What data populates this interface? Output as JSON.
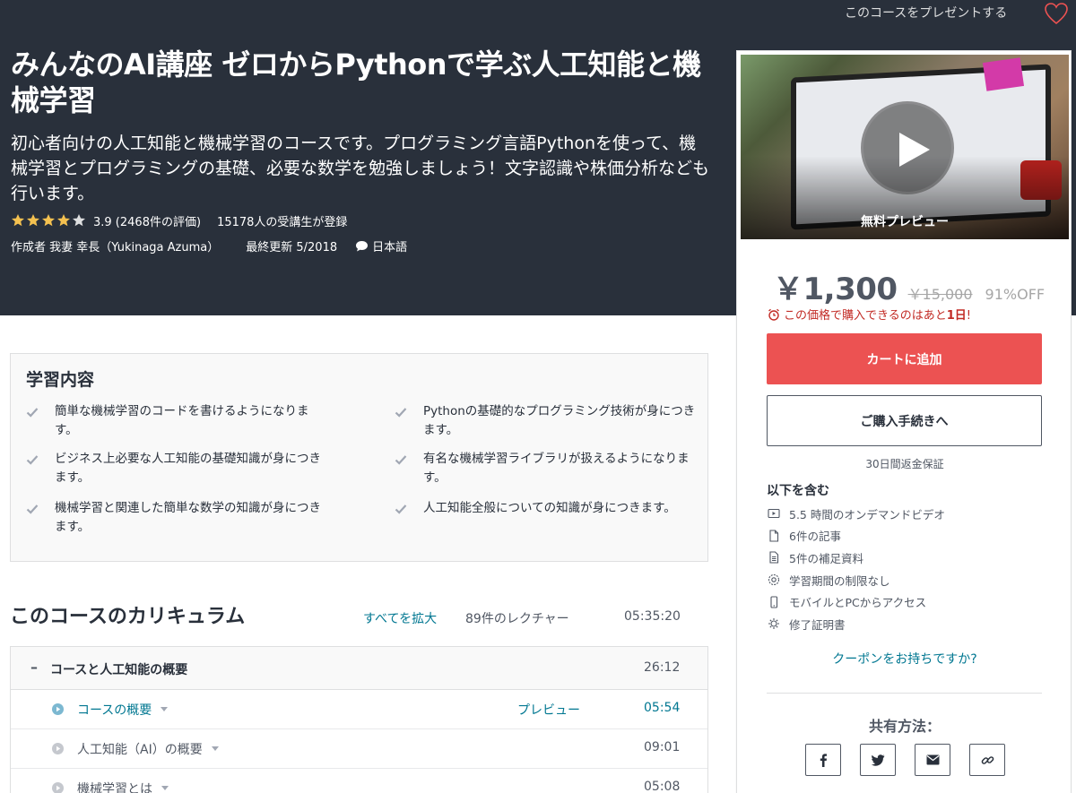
{
  "header": {
    "gift_label": "このコースをプレゼントする",
    "wishlist_icon": "heart-icon"
  },
  "course": {
    "title": "みんなのAI講座 ゼロからPythonで学ぶ人工知能と機械学習",
    "subtitle": "初心者向けの人工知能と機械学習のコースです。プログラミング言語Pythonを使って、機械学習とプログラミングの基礎、必要な数学を勉強しましょう！文字認識や株価分析なども行います。",
    "rating": 3.9,
    "rating_text": "3.9 (2468件の評価)",
    "stars_filled": 4,
    "stars_total": 5,
    "enrolled": "15178人の受講生が登録",
    "author": "作成者 我妻 幸長（Yukinaga Azuma）",
    "updated": "最終更新 5/2018",
    "language": "日本語",
    "star_color": "#f4c150"
  },
  "sidebar": {
    "preview_label": "無料プレビュー",
    "price": "￥1,300",
    "original_price": "￥15,000",
    "discount": "91%OFF",
    "timer_prefix": "この価格で購入できるのはあと",
    "timer_days": "1日",
    "timer_suffix": "!",
    "add_to_cart": "カートに追加",
    "buy_now": "ご購入手続きへ",
    "guarantee": "30日間返金保証",
    "includes_title": "以下を含む",
    "includes": [
      {
        "icon": "video-icon",
        "label": "5.5 時間のオンデマンドビデオ"
      },
      {
        "icon": "file-icon",
        "label": "6件の記事"
      },
      {
        "icon": "document-icon",
        "label": "5件の補足資料"
      },
      {
        "icon": "infinity-icon",
        "label": "学習期間の制限なし"
      },
      {
        "icon": "mobile-icon",
        "label": "モバイルとPCからアクセス"
      },
      {
        "icon": "certificate-icon",
        "label": "修了証明書"
      }
    ],
    "coupon": "クーポンをお持ちですか?",
    "share_title": "共有方法：",
    "share_icons": [
      "facebook-icon",
      "twitter-icon",
      "email-icon",
      "link-icon"
    ],
    "cart_color": "#ec5252"
  },
  "learn": {
    "title": "学習内容",
    "items": [
      "簡単な機械学習のコードを書けるようになります。",
      "Pythonの基礎的なプログラミング技術が身につきます。",
      "ビジネス上必要な人工知能の基礎知識が身につきます。",
      "有名な機械学習ライブラリが扱えるようになります。",
      "機械学習と関連した簡単な数学の知識が身につきます。",
      "人工知能全般についての知識が身につきます。"
    ]
  },
  "curriculum": {
    "title": "このコースのカリキュラム",
    "expand_all": "すべてを拡大",
    "lecture_count": "89件のレクチャー",
    "total_time": "05:35:20",
    "section": {
      "toggle": "–",
      "title": "コースと人工知能の概要",
      "time": "26:12"
    },
    "lectures": [
      {
        "title": "コースの概要",
        "preview": "プレビュー",
        "time": "05:54"
      },
      {
        "title": "人工知能（AI）の概要",
        "preview": "",
        "time": "09:01"
      },
      {
        "title": "機械学習とは",
        "preview": "",
        "time": "05:08"
      }
    ],
    "link_color": "#007791"
  }
}
